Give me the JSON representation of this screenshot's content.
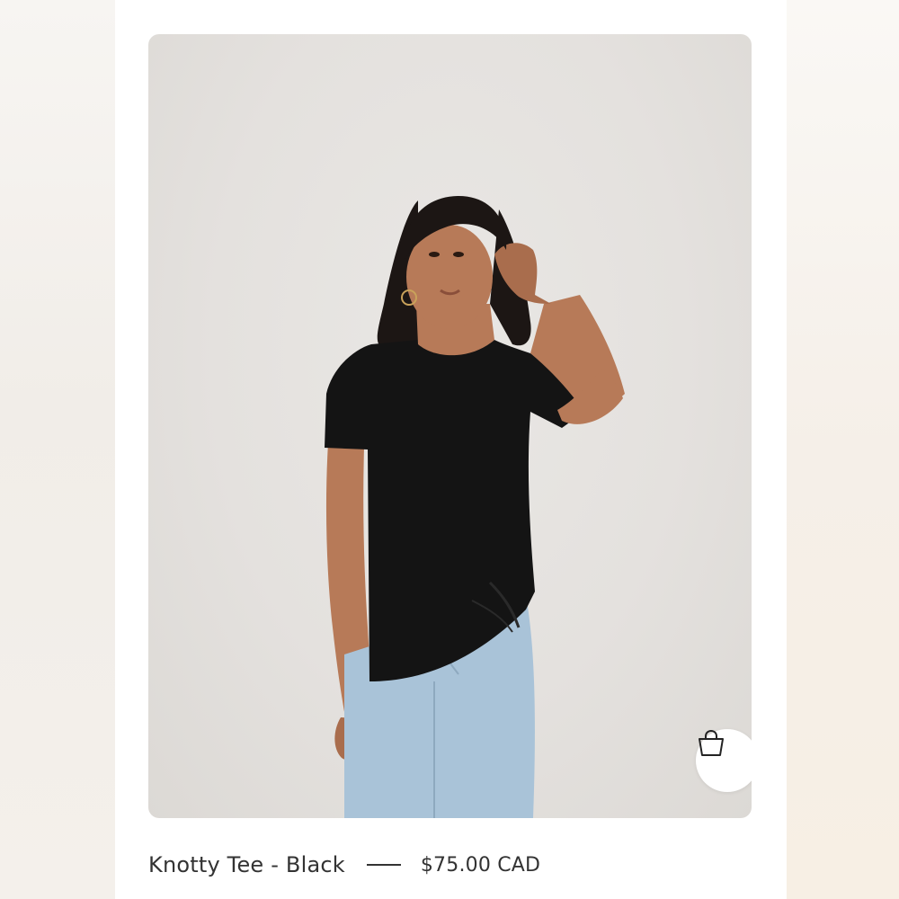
{
  "product": {
    "name": "Knotty Tee - Black",
    "price": "$75.00 CAD",
    "image_alt": "Model wearing a black knotted t-shirt with light blue jeans"
  },
  "actions": {
    "add_to_bag_icon": "shopping-bag-icon"
  },
  "colors": {
    "text": "#333333",
    "card_background": "#ffffff",
    "photo_background": "#e4e1de"
  }
}
